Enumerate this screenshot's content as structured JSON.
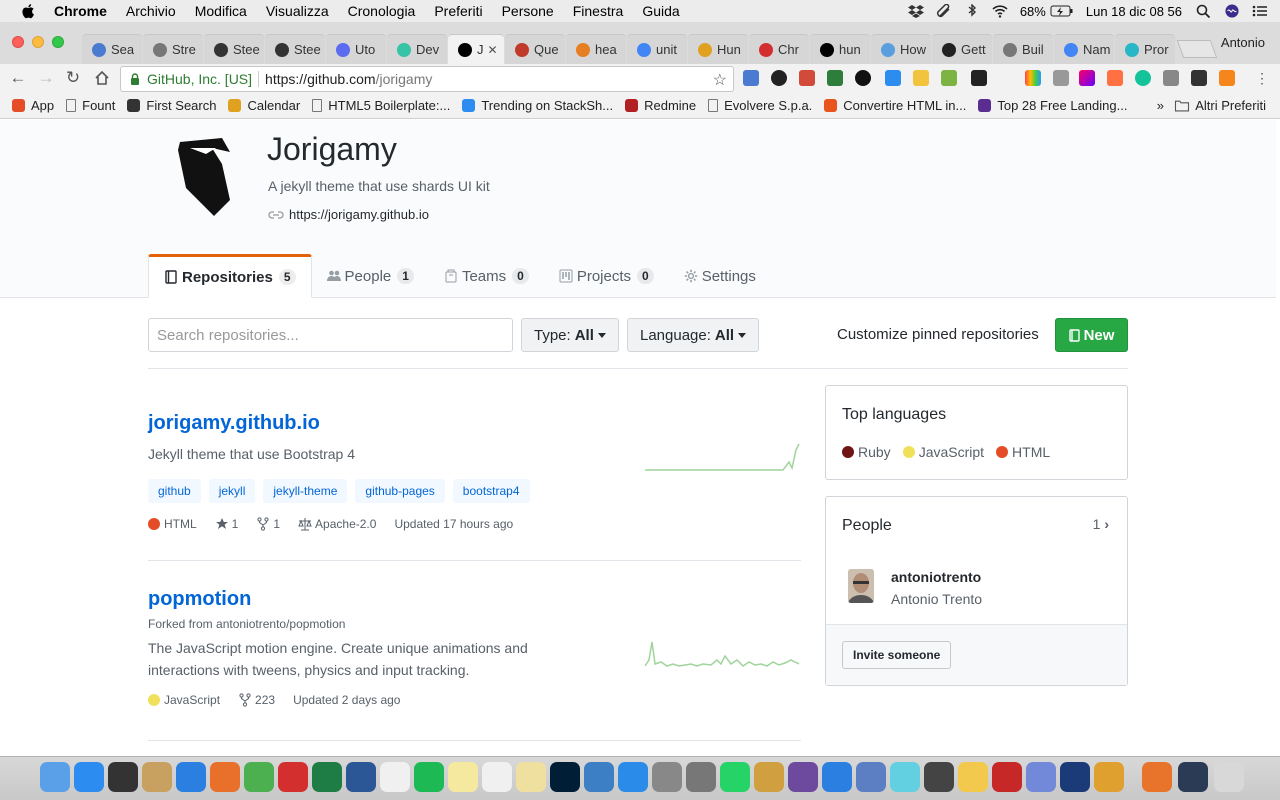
{
  "menubar": {
    "items": [
      "Chrome",
      "Archivio",
      "Modifica",
      "Visualizza",
      "Cronologia",
      "Preferiti",
      "Persone",
      "Finestra",
      "Guida"
    ],
    "battery": "68%",
    "datetime": "Lun 18 dic  08 56"
  },
  "browser": {
    "tabs": [
      {
        "label": "Sea",
        "icon": "calendar-icon",
        "color": "#4a7bd0"
      },
      {
        "label": "Stre",
        "icon": "page-icon",
        "color": "#777777"
      },
      {
        "label": "Stee",
        "icon": "bolt-icon",
        "color": "#333333"
      },
      {
        "label": "Stee",
        "icon": "bolt-icon",
        "color": "#333333"
      },
      {
        "label": "Uto",
        "icon": "circle-icon",
        "color": "#5b6cf0"
      },
      {
        "label": "Dev",
        "icon": "circle-icon",
        "color": "#36c3a6"
      },
      {
        "label": "J",
        "icon": "github-icon",
        "color": "#000000",
        "active": true
      },
      {
        "label": "Que",
        "icon": "bear-icon",
        "color": "#c0392b"
      },
      {
        "label": "hea",
        "icon": "chart-icon",
        "color": "#e67e22"
      },
      {
        "label": "unit",
        "icon": "google-icon",
        "color": "#4285f4"
      },
      {
        "label": "Hun",
        "icon": "face-icon",
        "color": "#e0a020"
      },
      {
        "label": "Chr",
        "icon": "diamond-icon",
        "color": "#d32f2f"
      },
      {
        "label": "hun",
        "icon": "github-icon",
        "color": "#000000"
      },
      {
        "label": "How",
        "icon": "badge-icon",
        "color": "#5a9ee0"
      },
      {
        "label": "Gett",
        "icon": "circle-icon",
        "color": "#222222"
      },
      {
        "label": "Buil",
        "icon": "page-icon",
        "color": "#777777"
      },
      {
        "label": "Nam",
        "icon": "google-icon",
        "color": "#4285f4"
      },
      {
        "label": "Pror",
        "icon": "letter-p-icon",
        "color": "#29b6c6"
      }
    ],
    "profile": "Antonio",
    "url": {
      "secure_label": "GitHub, Inc. [US]",
      "scheme_host": "https://github.com",
      "path": "/jorigamy"
    },
    "bookmarks": [
      {
        "label": "App",
        "icon": "apps-grid-icon",
        "color": "#e44d26"
      },
      {
        "label": "Fount",
        "icon": "page-icon",
        "color": "#777777"
      },
      {
        "label": "First Search",
        "icon": "bracket-icon",
        "color": "#333333"
      },
      {
        "label": "Calendar",
        "icon": "person-icon",
        "color": "#e0a020"
      },
      {
        "label": "HTML5 Boilerplate:...",
        "icon": "page-icon",
        "color": "#777777"
      },
      {
        "label": "Trending on StackSh...",
        "icon": "share-icon",
        "color": "#2d8cf0"
      },
      {
        "label": "Redmine",
        "icon": "arc-icon",
        "color": "#b32024"
      },
      {
        "label": "Evolvere S.p.a.",
        "icon": "page-icon",
        "color": "#777777"
      },
      {
        "label": "Convertire HTML in...",
        "icon": "circle-icon",
        "color": "#e8541c"
      },
      {
        "label": "Top 28 Free Landing...",
        "icon": "square-icon",
        "color": "#5a2d91"
      }
    ],
    "bookmarks_more": "»",
    "bookmarks_folder": "Altri Preferiti"
  },
  "org": {
    "name": "Jorigamy",
    "description": "A jekyll theme that use shards UI kit",
    "url": "https://jorigamy.github.io",
    "nav": [
      {
        "label": "Repositories",
        "count": "5",
        "icon": "repo-icon",
        "selected": true
      },
      {
        "label": "People",
        "count": "1",
        "icon": "people-icon"
      },
      {
        "label": "Teams",
        "count": "0",
        "icon": "team-icon"
      },
      {
        "label": "Projects",
        "count": "0",
        "icon": "project-icon"
      },
      {
        "label": "Settings",
        "count": "",
        "icon": "gear-icon"
      }
    ]
  },
  "filters": {
    "search_placeholder": "Search repositories...",
    "type_label": "Type:",
    "type_value": "All",
    "language_label": "Language:",
    "language_value": "All",
    "customize": "Customize pinned repositories",
    "new_button": "New"
  },
  "repos": [
    {
      "name": "jorigamy.github.io",
      "forked_from": "",
      "description": "Jekyll theme that use Bootstrap 4",
      "topics": [
        "github",
        "jekyll",
        "jekyll-theme",
        "github-pages",
        "bootstrap4"
      ],
      "language": "HTML",
      "language_color": "#e34c26",
      "stars": "1",
      "forks": "1",
      "license": "Apache-2.0",
      "updated": "Updated 17 hours ago"
    },
    {
      "name": "popmotion",
      "forked_from": "Forked from antoniotrento/popmotion",
      "description": "The JavaScript motion engine. Create unique animations and interactions with tweens, physics and input tracking.",
      "topics": [],
      "language": "JavaScript",
      "language_color": "#f1e05a",
      "stars": "",
      "forks": "223",
      "license": "",
      "updated": "Updated 2 days ago"
    }
  ],
  "sidebar": {
    "top_languages_title": "Top languages",
    "languages": [
      {
        "name": "Ruby",
        "color": "#701516"
      },
      {
        "name": "JavaScript",
        "color": "#f1e05a"
      },
      {
        "name": "HTML",
        "color": "#e34c26"
      }
    ],
    "people_title": "People",
    "people_count": "1",
    "member_login": "antoniotrento",
    "member_name": "Antonio Trento",
    "invite_button": "Invite someone"
  },
  "colors": {
    "link": "#0366d6",
    "accent_tab": "#e36209",
    "new_button": "#28a745",
    "sparkline": "#9fd49a"
  }
}
